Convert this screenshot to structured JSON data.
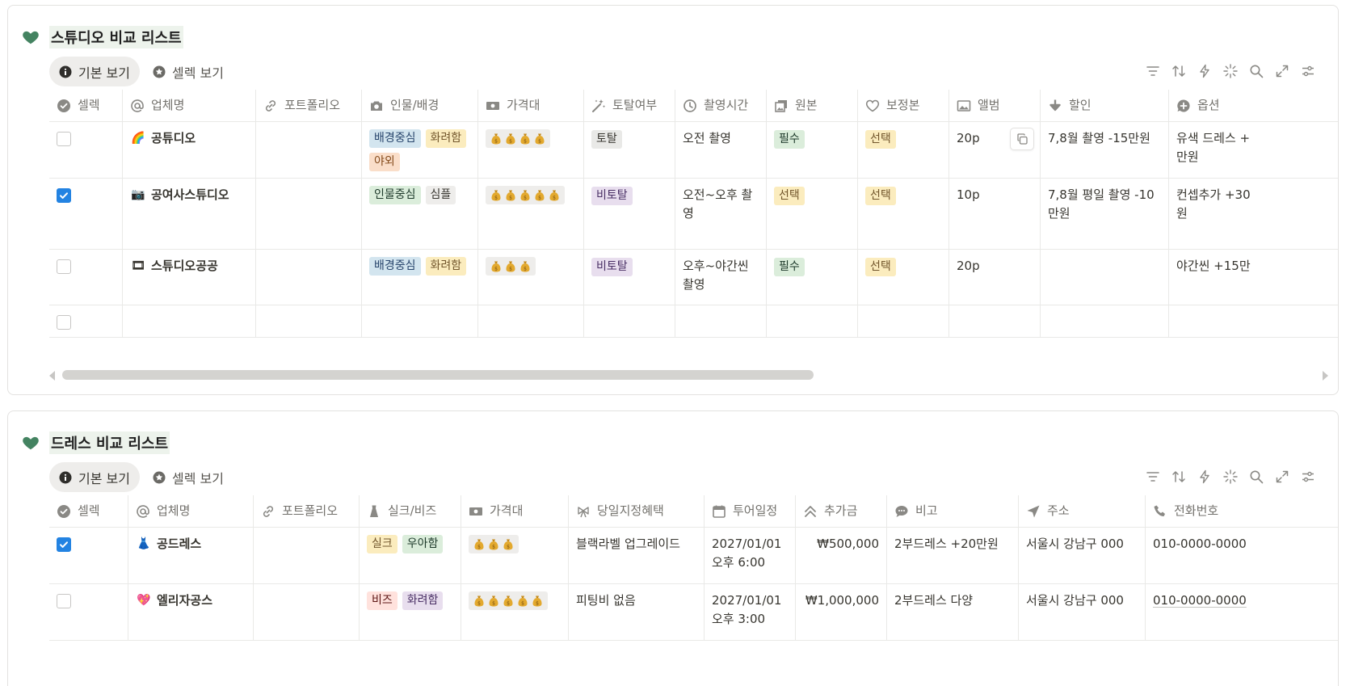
{
  "colors": {
    "heart": "#448361",
    "checkbox_on": "#2383e2"
  },
  "studio": {
    "title": "스튜디오 비교 리스트",
    "views": [
      "기본 보기",
      "셀렉 보기"
    ],
    "columns": [
      "셀렉",
      "업체명",
      "포트폴리오",
      "인물/배경",
      "가격대",
      "토탈여부",
      "촬영시간",
      "원본",
      "보정본",
      "앨범",
      "할인",
      "옵션"
    ],
    "rows": [
      {
        "checked": false,
        "emoji": "🌈",
        "name": "공튜디오",
        "portfolio": "",
        "style": [
          "배경중심",
          "화려함",
          "야외"
        ],
        "price": "💰💰💰💰",
        "total": "토탈",
        "time": "오전 촬영",
        "original": "필수",
        "retouched": "선택",
        "album": "20p",
        "discount": "7,8월 촬영 -15만원",
        "option": "유색 드레스 +\n만원"
      },
      {
        "checked": true,
        "emoji": "📷",
        "name": "공여사스튜디오",
        "portfolio": "",
        "style": [
          "인물중심",
          "심플"
        ],
        "price": "💰💰💰💰💰",
        "total": "비토탈",
        "time": "오전~오후 촬\n영",
        "original": "선택",
        "retouched": "선택",
        "album": "10p",
        "discount": "7,8월 평일 촬영 -10\n만원",
        "option": "컨셉추가 +30\n원"
      },
      {
        "checked": false,
        "emoji": "🎞",
        "name": "스튜디오공공",
        "portfolio": "",
        "style": [
          "배경중심",
          "화려함"
        ],
        "price": "💰💰💰",
        "total": "비토탈",
        "time": "오후~야간씬\n촬영",
        "original": "필수",
        "retouched": "선택",
        "album": "20p",
        "discount": "",
        "option": "야간씬 +15만"
      }
    ]
  },
  "dress": {
    "title": "드레스 비교 리스트",
    "views": [
      "기본 보기",
      "셀렉 보기"
    ],
    "columns": [
      "셀렉",
      "업체명",
      "포트폴리오",
      "실크/비즈",
      "가격대",
      "당일지정혜택",
      "투어일정",
      "추가금",
      "비고",
      "주소",
      "전화번호"
    ],
    "rows": [
      {
        "checked": true,
        "emoji": "👗",
        "name": "공드레스",
        "portfolio": "",
        "material": [
          "실크",
          "우아함"
        ],
        "price": "💰💰💰",
        "benefit": "블랙라벨 업그레이드",
        "tour": "2027/01/01\n오후 6:00",
        "extra": "₩500,000",
        "note": "2부드레스 +20만원",
        "address": "서울시 강남구 000",
        "phone": "010-0000-0000"
      },
      {
        "checked": false,
        "emoji": "💖",
        "name": "엘리자공스",
        "portfolio": "",
        "material": [
          "비즈",
          "화려함"
        ],
        "price": "💰💰💰💰💰",
        "benefit": "피팅비 없음",
        "tour": "2027/01/01\n오후 3:00",
        "extra": "₩1,000,000",
        "note": "2부드레스 다양",
        "address": "서울시 강남구 000",
        "phone": "010-0000-0000"
      }
    ]
  }
}
